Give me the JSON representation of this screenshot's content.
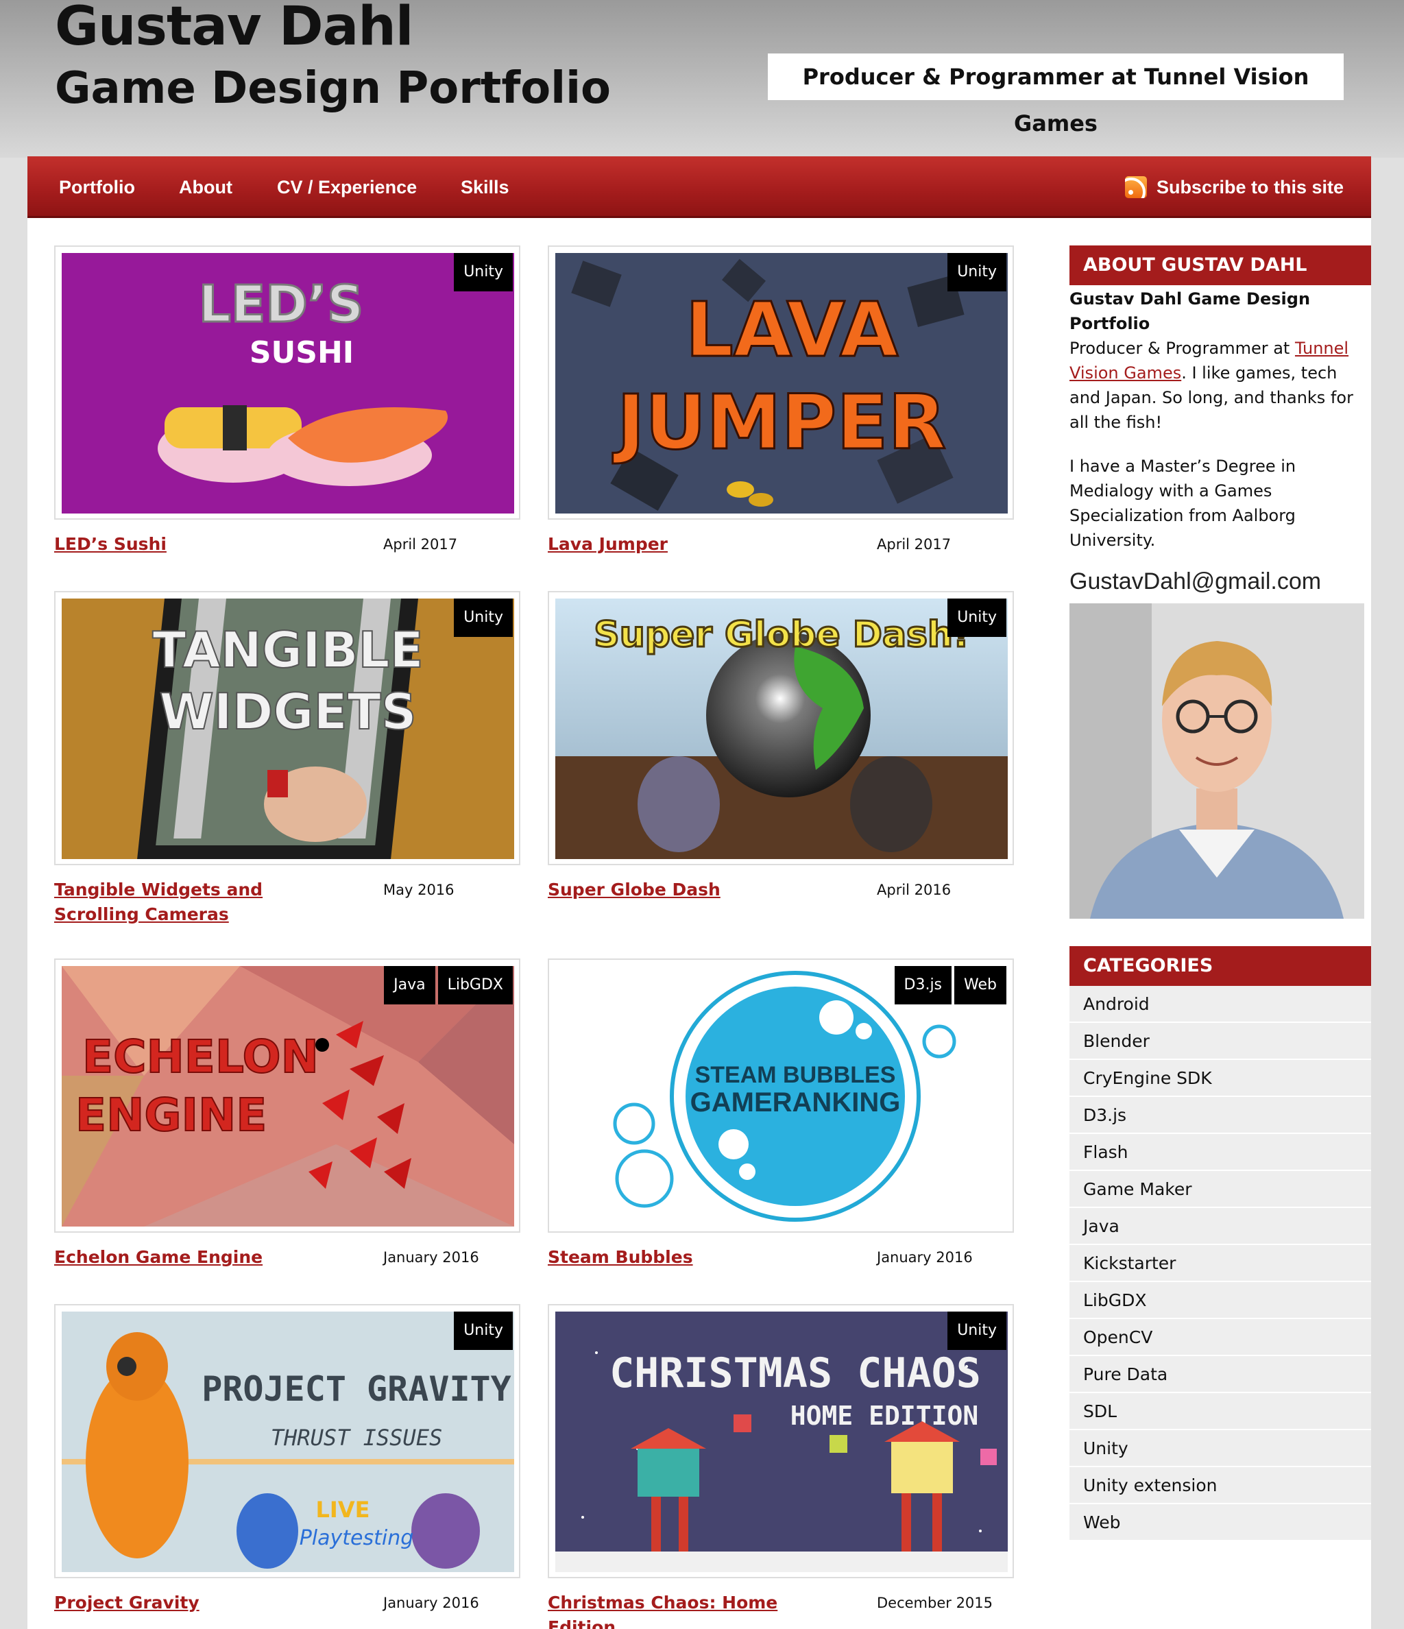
{
  "header": {
    "title": "Gustav Dahl",
    "subtitle": "Game Design Portfolio",
    "tagline": "Producer & Programmer at Tunnel Vision Games"
  },
  "nav": {
    "items": [
      "Portfolio",
      "About",
      "CV / Experience",
      "Skills"
    ],
    "subscribe": "Subscribe to this site",
    "subscribe_icon": "rss-icon"
  },
  "projects": [
    {
      "title": "LED’s Sushi",
      "date": "April 2017",
      "tags": [
        "Unity"
      ],
      "art_text": [
        "LED’S",
        "SUSHI"
      ]
    },
    {
      "title": "Lava Jumper",
      "date": "April 2017",
      "tags": [
        "Unity"
      ],
      "art_text": [
        "LAVA",
        "JUMPER"
      ]
    },
    {
      "title": "Tangible Widgets and Scrolling Cameras",
      "date": "May 2016",
      "tags": [
        "Unity"
      ],
      "art_text": [
        "TANGIBLE",
        "WIDGETS"
      ]
    },
    {
      "title": "Super Globe Dash",
      "date": "April 2016",
      "tags": [
        "Unity"
      ],
      "art_text": [
        "Super Globe Dash!"
      ]
    },
    {
      "title": "Echelon Game Engine",
      "date": "January 2016",
      "tags": [
        "Java",
        "LibGDX"
      ],
      "art_text": [
        "ECHELON",
        "ENGINE"
      ]
    },
    {
      "title": "Steam Bubbles",
      "date": "January 2016",
      "tags": [
        "D3.js",
        "Web"
      ],
      "art_text": [
        "STEAM BUBBLES",
        "GAMERANKING"
      ]
    },
    {
      "title": "Project Gravity",
      "date": "January 2016",
      "tags": [
        "Unity"
      ],
      "art_text": [
        "PROJECT GRAVITY",
        "THRUST ISSUES",
        "LIVE",
        "Playtesting"
      ]
    },
    {
      "title": "Christmas Chaos: Home Edition",
      "date": "December 2015",
      "tags": [
        "Unity"
      ],
      "art_text": [
        "CHRISTMAS CHAOS",
        "HOME EDITION"
      ]
    }
  ],
  "sidebar": {
    "about_heading": "ABOUT GUSTAV DAHL",
    "about_bold": "Gustav Dahl Game Design Portfolio",
    "about_p1_pre": "Producer & Programmer at ",
    "about_p1_link": "Tunnel Vision Games",
    "about_p1_post": ". I like games, tech and Japan. So long, and thanks for all the fish!",
    "about_p2": "I have a Master’s Degree in Medialogy with a Games Specialization from Aalborg University.",
    "email": "GustavDahl@gmail.com",
    "categories_heading": "CATEGORIES",
    "categories": [
      "Android",
      "Blender",
      "CryEngine SDK",
      "D3.js",
      "Flash",
      "Game Maker",
      "Java",
      "Kickstarter",
      "LibGDX",
      "OpenCV",
      "Pure Data",
      "SDL",
      "Unity",
      "Unity extension",
      "Web"
    ]
  },
  "colors": {
    "accent": "#a41c1c",
    "nav_gradient_top": "#c3302c",
    "link": "#a41c1c"
  }
}
